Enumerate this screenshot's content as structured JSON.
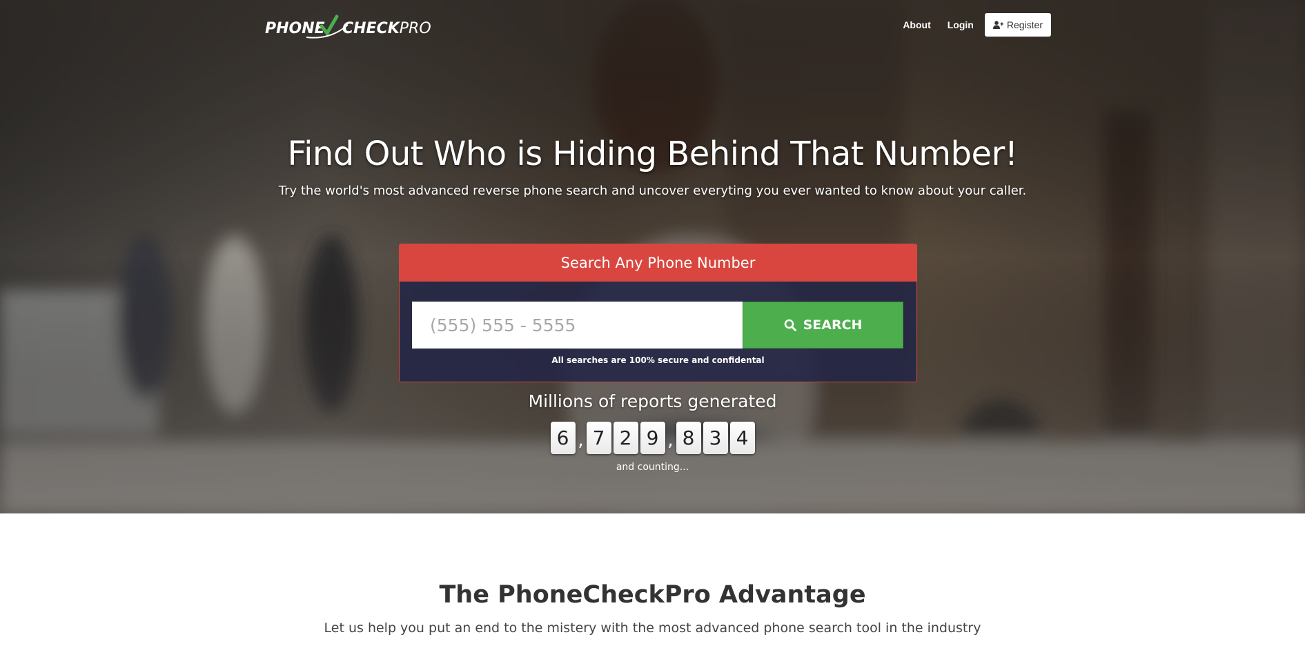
{
  "brand": {
    "logo_text_left": "PHONE",
    "logo_text_right": "CHECKPRO",
    "accent": "#4cae4c"
  },
  "nav": {
    "about": "About",
    "login": "Login",
    "register": "Register",
    "register_icon": "user-plus-icon"
  },
  "hero": {
    "headline": "Find Out Who is Hiding Behind That Number!",
    "subline": "Try the world's most advanced reverse phone search and uncover everyting you ever wanted to know about your caller."
  },
  "search": {
    "header": "Search Any Phone Number",
    "placeholder": "(555) 555 - 5555",
    "button_label": "SEARCH",
    "button_icon": "search-icon",
    "secure_note": "All searches are 100% secure and confidental",
    "header_color": "#d9463f",
    "button_color": "#4cae4c"
  },
  "counter": {
    "title": "Millions of reports generated",
    "digits": [
      "6",
      ",",
      "7",
      "2",
      "9",
      ",",
      "8",
      "3",
      "4"
    ],
    "footer": "and counting..."
  },
  "advantage": {
    "title": "The PhoneCheckPro Advantage",
    "subtitle": "Let us help you put an end to the mistery with the most advanced phone search tool in the industry"
  }
}
